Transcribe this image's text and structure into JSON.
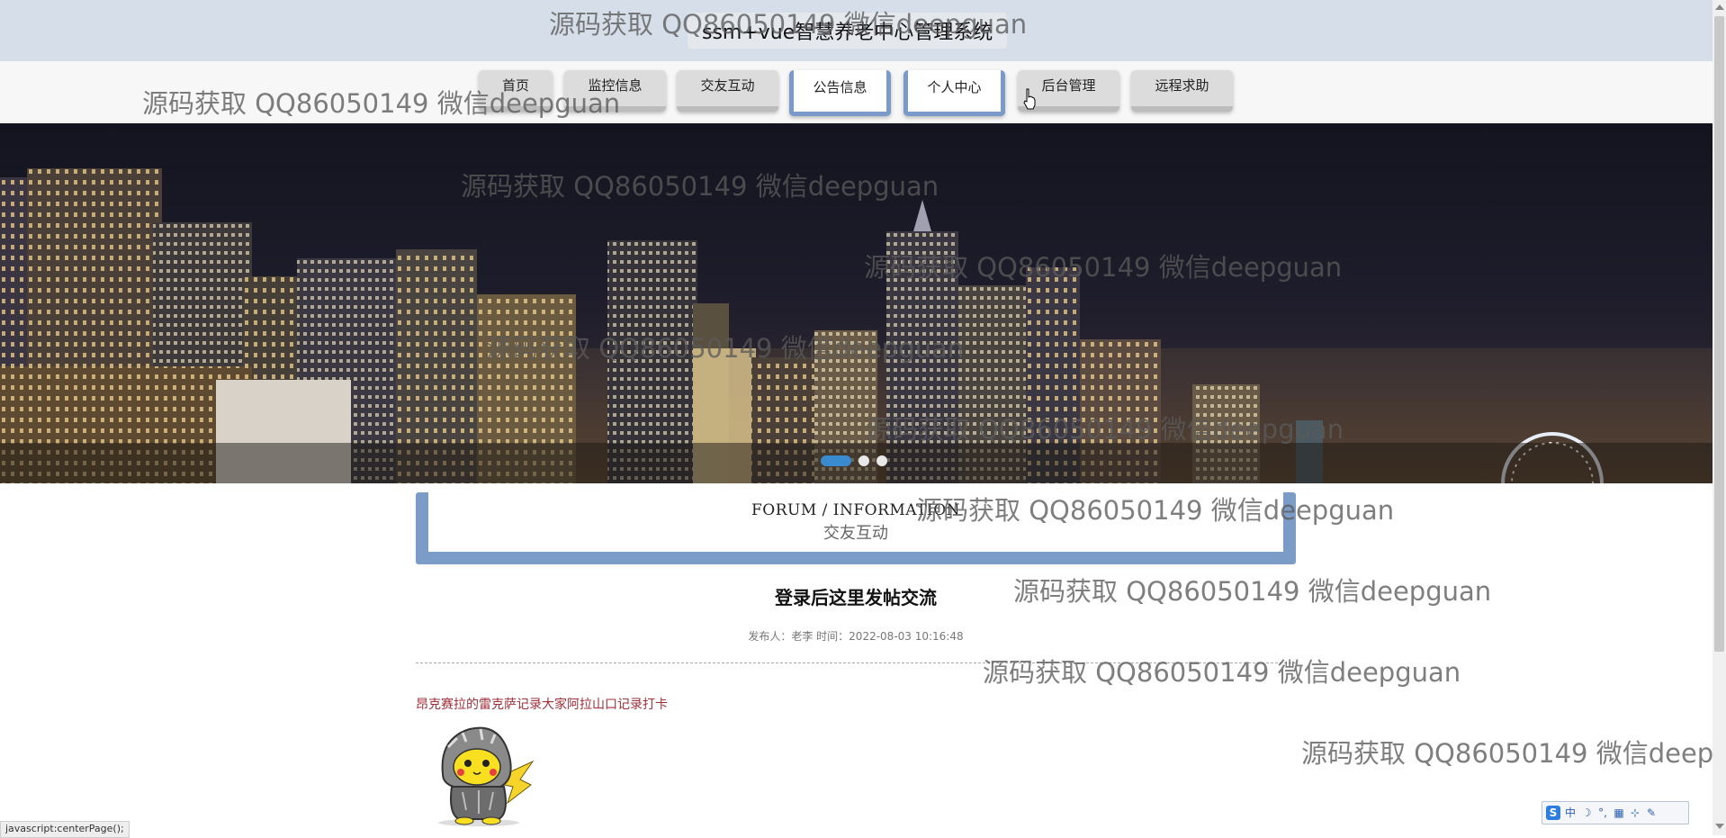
{
  "app_title": "ssm+vue智慧养老中心管理系统",
  "nav": {
    "items": [
      {
        "label": "首页"
      },
      {
        "label": "监控信息"
      },
      {
        "label": "交友互动"
      },
      {
        "label": "公告信息"
      },
      {
        "label": "个人中心"
      },
      {
        "label": "后台管理"
      },
      {
        "label": "远程求助"
      }
    ],
    "active": [
      "公告信息",
      "个人中心"
    ]
  },
  "carousel": {
    "slide_count": 3,
    "active_index": 0
  },
  "section": {
    "title_en": "FORUM / INFORMATION",
    "title_cn": "交友互动"
  },
  "post": {
    "title": "登录后这里发帖交流",
    "meta": "发布人：老李 时间：2022-08-03 10:16:48",
    "body": "昂克赛拉的雷克萨记录大家阿拉山口记录打卡"
  },
  "watermark_text": "源码获取 QQ86050149 微信deepguan",
  "status_bar_text": "javascript:centerPage();",
  "ime": {
    "labels": [
      "中",
      "☽",
      "°,",
      "▦",
      "⊹",
      "✎"
    ]
  },
  "colors": {
    "accent": "#7b9cc7",
    "topbar_bg": "#d6dfe9",
    "post_body": "#a0303a"
  }
}
